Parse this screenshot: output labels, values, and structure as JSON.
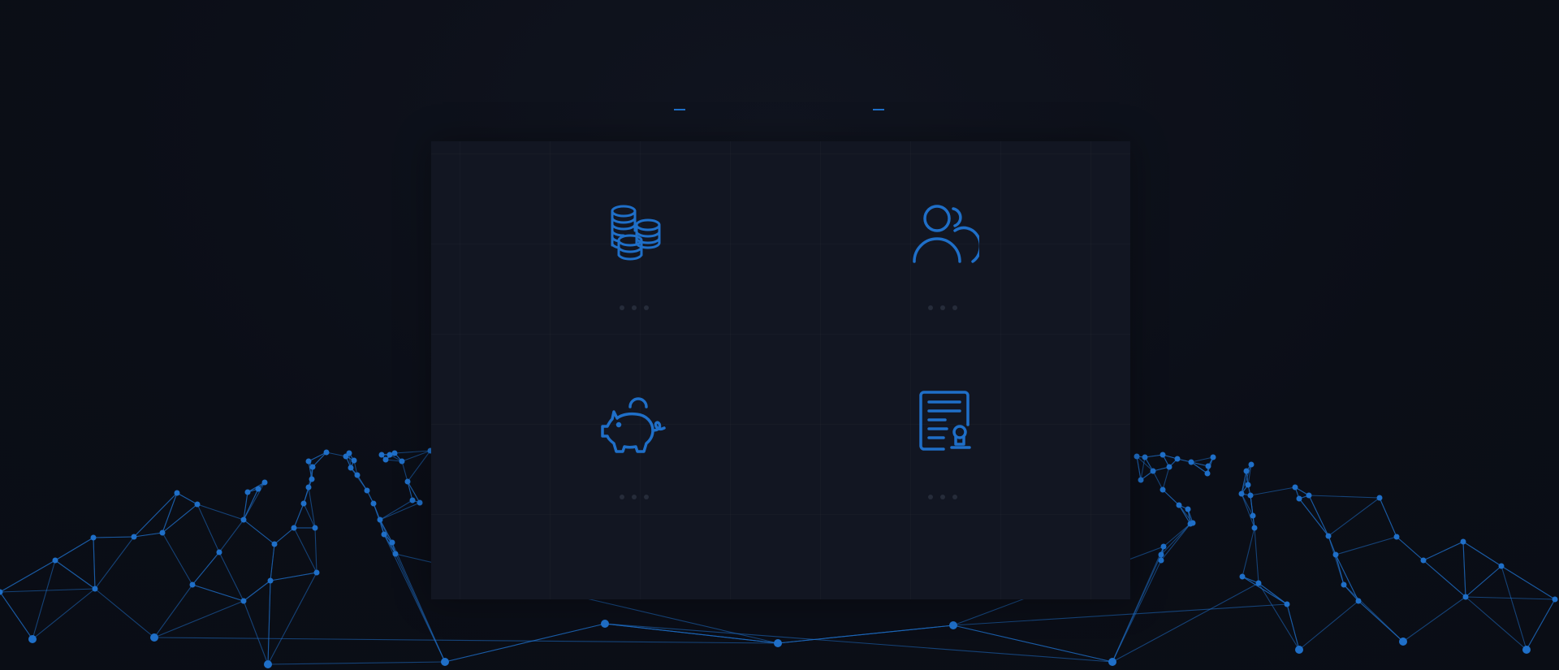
{
  "tabs": [
    {
      "id": "tab-1",
      "label": ""
    },
    {
      "id": "tab-2",
      "label": ""
    }
  ],
  "colors": {
    "accent": "#1f6fc8",
    "background": "#0b0e17",
    "panel": "#121622",
    "dots": "#262c3a"
  },
  "cards": [
    {
      "icon": "coins-stack-icon",
      "label": ""
    },
    {
      "icon": "users-icon",
      "label": ""
    },
    {
      "icon": "piggy-bank-icon",
      "label": ""
    },
    {
      "icon": "certificate-document-icon",
      "label": ""
    }
  ]
}
